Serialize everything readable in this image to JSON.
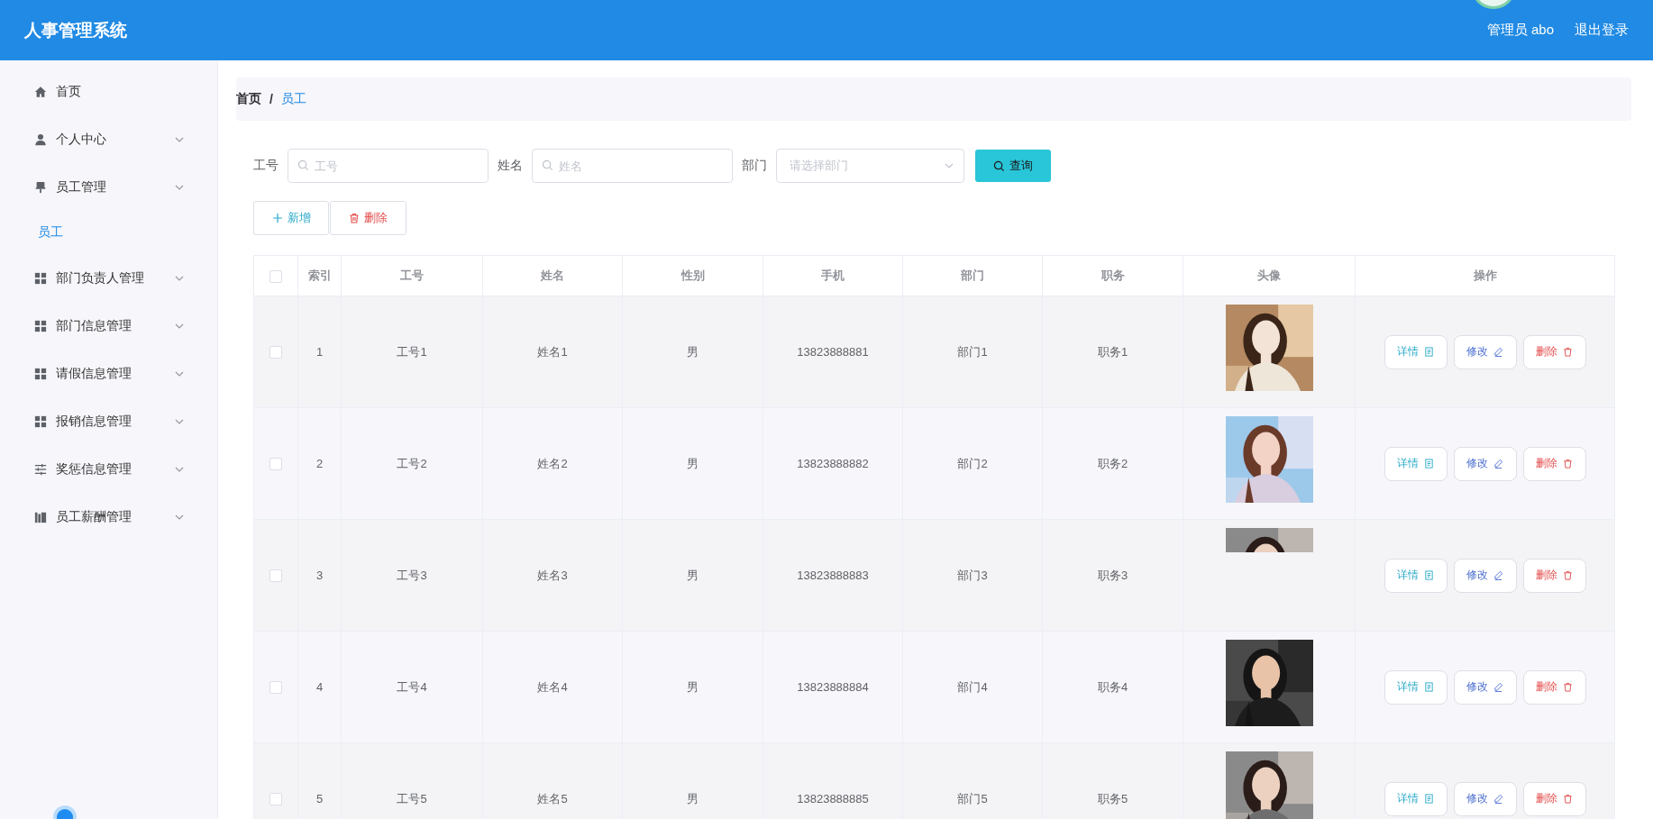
{
  "header": {
    "title": "人事管理系统",
    "user": "管理员 abo",
    "logout": "退出登录"
  },
  "sidebar": {
    "items": [
      {
        "label": "首页",
        "kind": "home",
        "selected": false
      },
      {
        "label": "个人中心",
        "kind": "user",
        "selected": false
      },
      {
        "label": "员工管理",
        "kind": "stamp",
        "selected": false,
        "children": [
          {
            "label": "员工",
            "selected": true
          }
        ]
      },
      {
        "label": "部门负责人管理",
        "kind": "grid",
        "selected": false
      },
      {
        "label": "部门信息管理",
        "kind": "grid",
        "selected": false
      },
      {
        "label": "请假信息管理",
        "kind": "grid",
        "selected": false
      },
      {
        "label": "报销信息管理",
        "kind": "grid",
        "selected": false
      },
      {
        "label": "奖惩信息管理",
        "kind": "sliders",
        "selected": false
      },
      {
        "label": "员工薪酬管理",
        "kind": "chart",
        "selected": false
      }
    ]
  },
  "breadcrumb": {
    "items": [
      {
        "label": "首页",
        "current": false
      },
      {
        "label": "员工",
        "current": true
      }
    ],
    "separator": "/"
  },
  "search": {
    "fields": [
      {
        "label": "工号",
        "placeholder": "工号",
        "kind": "input"
      },
      {
        "label": "姓名",
        "placeholder": "姓名",
        "kind": "input"
      },
      {
        "label": "部门",
        "placeholder": "请选择部门",
        "kind": "select"
      }
    ],
    "button": "查询"
  },
  "actions": [
    {
      "label": "新增",
      "kind": "add"
    },
    {
      "label": "删除",
      "kind": "delete"
    }
  ],
  "table": {
    "select_all": false,
    "columns": [
      "索引",
      "工号",
      "姓名",
      "性别",
      "手机",
      "部门",
      "职务",
      "头像",
      "操作"
    ],
    "rows": [
      {
        "checked": false,
        "cells": [
          "1",
          "工号1",
          "姓名1",
          "男",
          "13823888881",
          "部门1",
          "职务1"
        ],
        "actions": [
          "详情",
          "修改",
          "删除"
        ]
      },
      {
        "checked": false,
        "cells": [
          "2",
          "工号2",
          "姓名2",
          "男",
          "13823888882",
          "部门2",
          "职务2"
        ],
        "actions": [
          "详情",
          "修改",
          "删除"
        ]
      },
      {
        "checked": false,
        "cells": [
          "3",
          "工号3",
          "姓名3",
          "男",
          "13823888883",
          "部门3",
          "职务3"
        ],
        "avatar": {
          "kind": "strip"
        },
        "actions": [
          "详情",
          "修改",
          "删除"
        ]
      },
      {
        "checked": false,
        "cells": [
          "4",
          "工号4",
          "姓名4",
          "男",
          "13823888884",
          "部门4",
          "职务4"
        ],
        "actions": [
          "详情",
          "修改",
          "删除"
        ]
      },
      {
        "checked": false,
        "cells": [
          "5",
          "工号5",
          "姓名5",
          "男",
          "13823888885",
          "部门5",
          "职务5"
        ],
        "actions": [
          "详情",
          "修改",
          "删除"
        ]
      }
    ]
  }
}
